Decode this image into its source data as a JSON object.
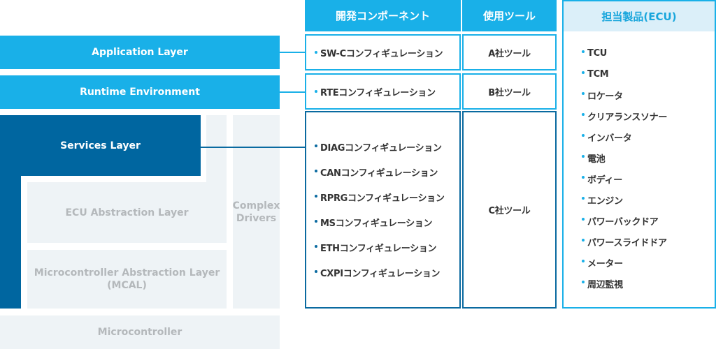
{
  "layers": {
    "application": "Application Layer",
    "runtime": "Runtime Environment",
    "services": "Services Layer",
    "ecu_abstraction": "ECU Abstraction Layer",
    "mcal_line1": "Microcontroller Abstraction Layer",
    "mcal_line2": "(MCAL)",
    "complex_line1": "Complex",
    "complex_line2": "Drivers",
    "microcontroller": "Microcontroller"
  },
  "table": {
    "headers": {
      "component": "開発コンポーネント",
      "tool": "使用ツール",
      "product": "担当製品(ECU)"
    },
    "rows": [
      {
        "components": [
          "SW-Cコンフィギュレーション"
        ],
        "tool": "A社ツール"
      },
      {
        "components": [
          "RTEコンフィギュレーション"
        ],
        "tool": "B社ツール"
      },
      {
        "components": [
          "DIAGコンフィギュレーション",
          "CANコンフィギュレーション",
          "RPRGコンフィギュレーション",
          "MSコンフィギュレーション",
          "ETHコンフィギュレーション",
          "CXPIコンフィギュレーション"
        ],
        "tool": "C社ツール"
      }
    ],
    "products": [
      "TCU",
      "TCM",
      "ロケータ",
      "クリアランスソナー",
      "インバータ",
      "電池",
      "ボディー",
      "エンジン",
      "パワーバックドア",
      "パワースライドドア",
      "メーター",
      "周辺監視"
    ]
  },
  "colors": {
    "light_blue": "#19b0e8",
    "dark_blue": "#0066a0",
    "grey": "#eef3f6",
    "grey_text": "#b4b8bb",
    "product_header_bg": "#dbeff9"
  }
}
